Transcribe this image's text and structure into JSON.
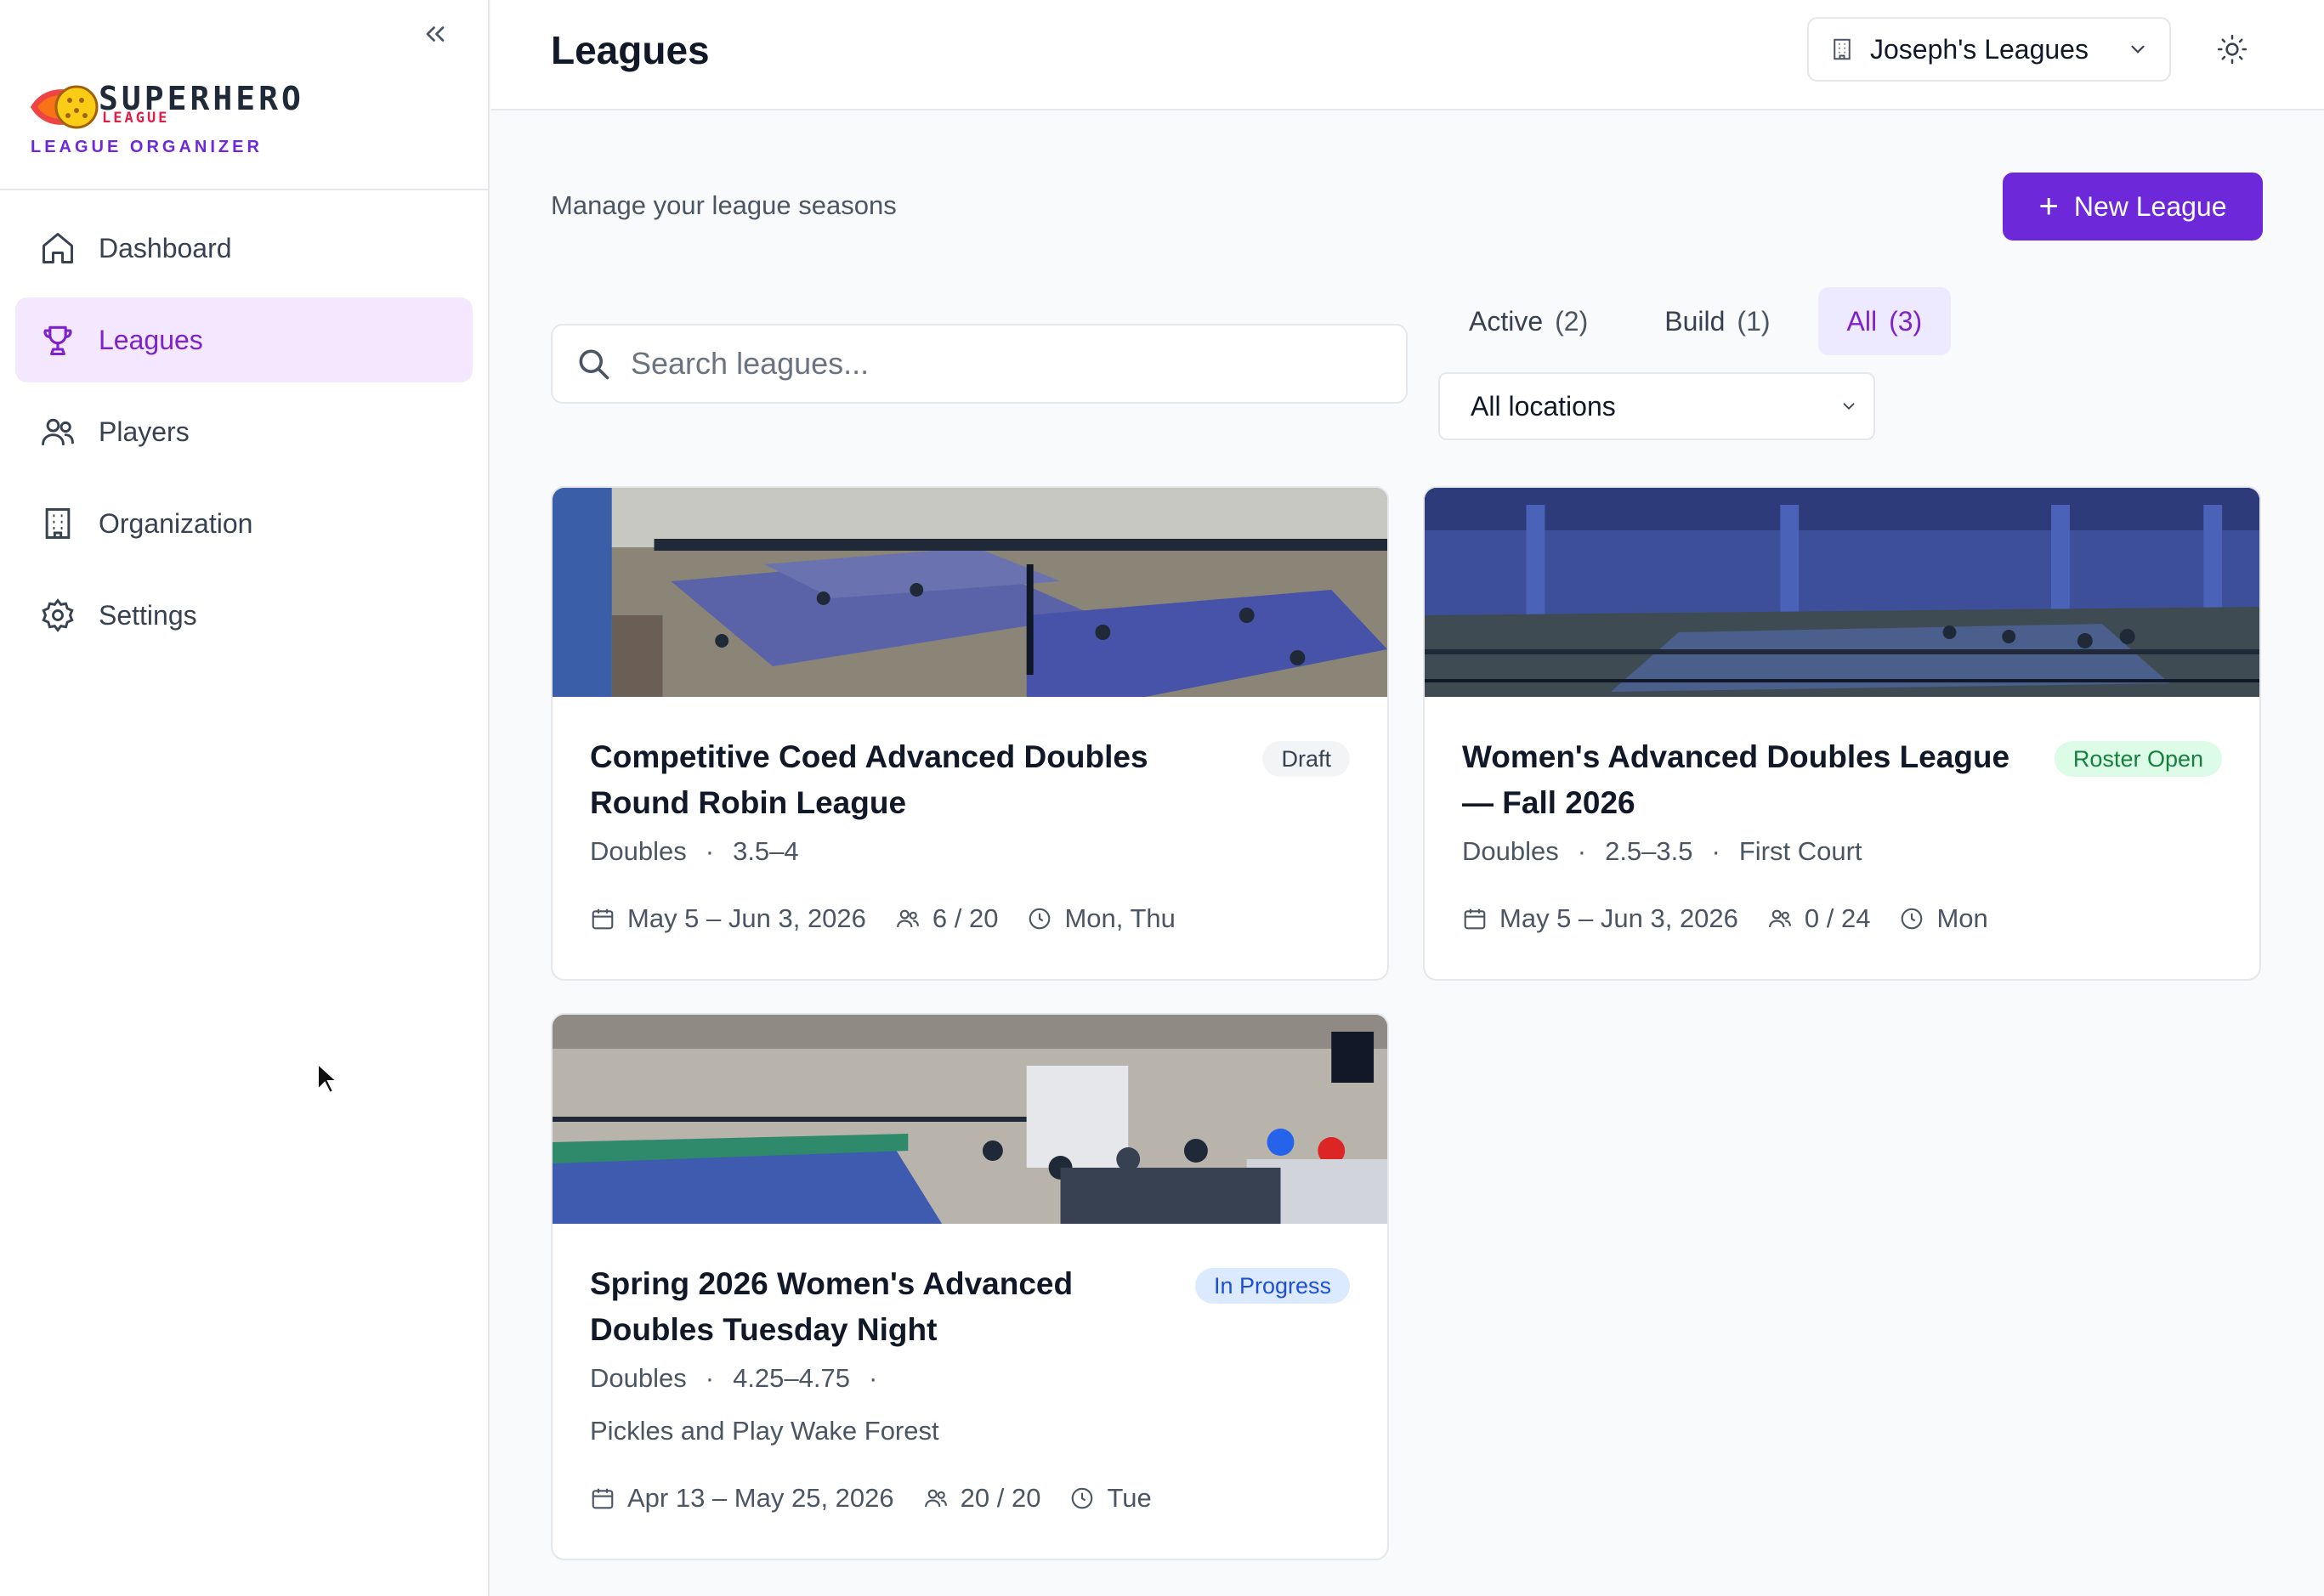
{
  "sidebar": {
    "logo": {
      "word": "SUPERHERO",
      "sub": "LEAGUE",
      "tagline": "LEAGUE ORGANIZER"
    },
    "collapse_icon": "double-chevron-left-icon",
    "items": [
      {
        "label": "Dashboard",
        "icon": "home-icon"
      },
      {
        "label": "Leagues",
        "icon": "trophy-icon",
        "active": true
      },
      {
        "label": "Players",
        "icon": "users-icon"
      },
      {
        "label": "Organization",
        "icon": "building-icon"
      },
      {
        "label": "Settings",
        "icon": "gear-icon"
      }
    ]
  },
  "header": {
    "title": "Leagues",
    "org_selector": "Joseph's Leagues",
    "theme_icon": "sun-icon"
  },
  "main": {
    "subtitle": "Manage your league seasons",
    "new_button": "New League",
    "search": {
      "placeholder": "Search leagues...",
      "value": ""
    },
    "tabs": [
      {
        "label": "Active",
        "count": "(2)"
      },
      {
        "label": "Build",
        "count": "(1)"
      },
      {
        "label": "All",
        "count": "(3)",
        "active": true
      }
    ],
    "location_filter": "All locations",
    "cards": [
      {
        "title": "Competitive Coed Advanced Doubles Round Robin League",
        "status": "Draft",
        "format": "Doubles",
        "rating": "3.5–4",
        "dates": "May 5 – Jun 3, 2026",
        "players": "6 / 20",
        "days": "Mon, Thu"
      },
      {
        "title": "Women's Advanced Doubles League — Fall 2026",
        "status": "Roster Open",
        "format": "Doubles",
        "rating": "2.5–3.5",
        "location": "First Court",
        "dates": "May 5 – Jun 3, 2026",
        "players": "0 / 24",
        "days": "Mon"
      },
      {
        "title": "Spring 2026 Women's Advanced Doubles Tuesday Night",
        "status": "In Progress",
        "format": "Doubles",
        "rating": "4.25–4.75",
        "location": "Pickles and Play Wake Forest",
        "dates": "Apr 13 – May 25, 2026",
        "players": "20 / 20",
        "days": "Tue"
      }
    ]
  },
  "colors": {
    "accent": "#6d28d9",
    "active_nav_bg": "#f3e8ff",
    "draft_badge": "#f3f4f6",
    "roster_open_badge": "#dcfce7",
    "in_progress_badge": "#dbeafe"
  }
}
